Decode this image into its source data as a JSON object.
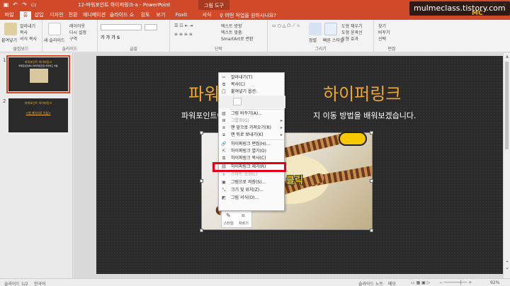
{
  "titlebar": {
    "title": "12-파워포인트 하이퍼링크-a - PowerPoint",
    "context_tab": "그림 도구",
    "qat_icons": [
      "save-icon",
      "undo-icon",
      "redo-icon",
      "slideshow-icon"
    ],
    "window_icons": [
      "minimize-icon",
      "maximize-icon",
      "close-icon"
    ]
  },
  "watermark": "mulmeclass.tistory.com",
  "tabs": [
    {
      "label": "파일"
    },
    {
      "label": "홈"
    },
    {
      "label": "삽입"
    },
    {
      "label": "디자인"
    },
    {
      "label": "전환"
    },
    {
      "label": "애니메이션"
    },
    {
      "label": "슬라이드 쇼"
    },
    {
      "label": "검토"
    },
    {
      "label": "보기"
    },
    {
      "label": "Foxit PDF"
    },
    {
      "label": "서식"
    }
  ],
  "tell_me": "♀ 어떤 작업을 원하시나요?",
  "ribbon": {
    "clipboard": {
      "label": "클립보드",
      "paste": "붙여넣기",
      "cut": "잘라내기",
      "copy": "복사",
      "format_painter": "서식 복사"
    },
    "slides": {
      "label": "슬라이드",
      "new_slide": "새 슬라이드",
      "layout": "레이아웃",
      "reset": "다시 설정",
      "section": "구역"
    },
    "font": {
      "label": "글꼴"
    },
    "paragraph": {
      "label": "단락",
      "text_direction": "텍스트 방향",
      "align_text": "텍스트 맞춤",
      "smartart": "SmartArt로 변환"
    },
    "drawing": {
      "label": "그리기",
      "arrange": "정렬",
      "quick_styles": "빠른 스타일",
      "fill": "도형 채우기",
      "outline": "도형 윤곽선",
      "effects": "도형 효과"
    },
    "editing": {
      "label": "편집",
      "find": "찾기",
      "replace": "바꾸기",
      "select": "선택"
    }
  },
  "thumbnails": [
    {
      "num": "1",
      "title": "파워포인트 하이퍼링크",
      "body": "파워포인트에서 하이퍼링크로 슬라이드 이동"
    },
    {
      "num": "2",
      "title": "파워포인트 하이퍼링크",
      "link": "<첫 페이지로 이동>"
    }
  ],
  "slide": {
    "title_left": "파워",
    "title_right": "하이퍼링크",
    "subtitle_left": "파워포인트에",
    "subtitle_right": "지 이동 방법을 배워보겠습니다."
  },
  "annotation": "클릭",
  "context_menu": {
    "items": [
      {
        "label": "잘라내기(T)",
        "icon": "cut-icon",
        "disabled": false
      },
      {
        "label": "복사(C)",
        "icon": "copy-icon",
        "disabled": false
      },
      {
        "label": "붙여넣기 옵션:",
        "icon": "paste-icon",
        "disabled": false
      },
      {
        "label": "그림 바꾸기(A)...",
        "icon": "change-picture-icon",
        "disabled": false
      },
      {
        "label": "그룹화(G)",
        "icon": "group-icon",
        "disabled": true
      },
      {
        "label": "맨 앞으로 가져오기(R)",
        "icon": "bring-front-icon",
        "disabled": false
      },
      {
        "label": "맨 뒤로 보내기(K)",
        "icon": "send-back-icon",
        "disabled": false
      },
      {
        "label": "하이퍼링크 편집(H)...",
        "icon": "hyperlink-icon",
        "disabled": false
      },
      {
        "label": "하이퍼링크 열기(O)",
        "icon": "open-link-icon",
        "disabled": false
      },
      {
        "label": "하이퍼링크 복사(C)",
        "icon": "copy-link-icon",
        "disabled": false
      },
      {
        "label": "하이퍼링크 제거(R)",
        "icon": "remove-link-icon",
        "disabled": false
      },
      {
        "label": "스마트 조회(L)",
        "icon": "search-icon",
        "disabled": true
      },
      {
        "label": "그림으로 저장(S)...",
        "icon": "save-picture-icon",
        "disabled": false
      },
      {
        "label": "크기 및 위치(Z)...",
        "icon": "size-icon",
        "disabled": false
      },
      {
        "label": "그림 서식(O)...",
        "icon": "format-icon",
        "disabled": false
      }
    ]
  },
  "mini_toolbar": {
    "style": "스타일",
    "crop": "자르기"
  },
  "statusbar": {
    "slide_pos": "슬라이드 1/2",
    "language": "한국어",
    "notes": "슬라이드 노트",
    "comments": "메모",
    "zoom": "92%"
  },
  "colors": {
    "accent": "#d04a2a",
    "slide_bg": "#2a2a2a",
    "title": "#f0a830",
    "highlight": "#e3001b"
  }
}
